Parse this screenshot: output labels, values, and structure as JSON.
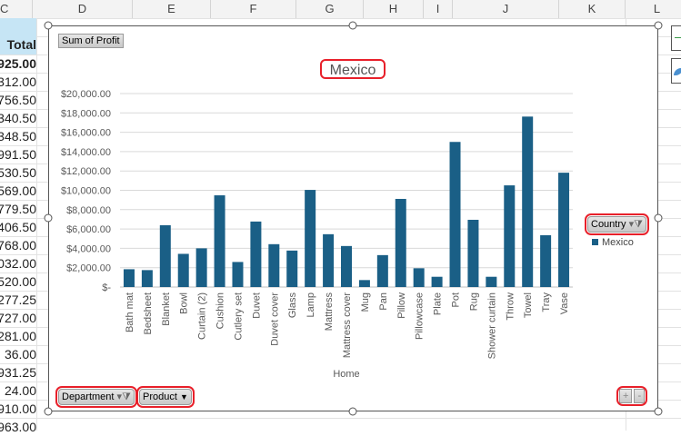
{
  "columns": [
    "C",
    "D",
    "E",
    "F",
    "G",
    "H",
    "I",
    "J",
    "K",
    "L"
  ],
  "left_column": {
    "header": "Total",
    "values": [
      "925.00",
      "312.00",
      "756.50",
      "340.50",
      "348.50",
      "991.50",
      "530.50",
      "569.00",
      "779.50",
      "406.50",
      "768.00",
      "032.00",
      "520.00",
      "277.25",
      "727.00",
      "281.00",
      "36.00",
      "931.25",
      "24.00",
      "910.00",
      "963.00"
    ]
  },
  "chart": {
    "value_field_button": "Sum of Profit",
    "legend_field_button": "Country",
    "axis_field_buttons": [
      "Department",
      "Product"
    ],
    "zoom_buttons": [
      "+",
      "-"
    ],
    "bar_color": "#1a5f86",
    "highlight_color": "#e8202a"
  },
  "chart_data": {
    "type": "bar",
    "title": "Mexico",
    "xlabel": "Home",
    "ylabel": "",
    "ylim": [
      0,
      20000
    ],
    "yticks": [
      "$-",
      "$2,000.00",
      "$4,000.00",
      "$6,000.00",
      "$8,000.00",
      "$10,000.00",
      "$12,000.00",
      "$14,000.00",
      "$16,000.00",
      "$18,000.00",
      "$20,000.00"
    ],
    "grid": true,
    "legend_position": "right",
    "categories": [
      "Bath mat",
      "Bedsheet",
      "Blanket",
      "Bowl",
      "Curtain (2)",
      "Cushion",
      "Cutlery set",
      "Duvet",
      "Duvet cover",
      "Glass",
      "Lamp",
      "Mattress",
      "Mattress cover",
      "Mug",
      "Pan",
      "Pillow",
      "Pillowcase",
      "Plate",
      "Pot",
      "Rug",
      "Shower curtain",
      "Throw",
      "Towel",
      "Tray",
      "Vase"
    ],
    "series": [
      {
        "name": "Mexico",
        "values": [
          1840,
          1750,
          6390,
          3430,
          4000,
          9480,
          2590,
          6770,
          4430,
          3770,
          10040,
          5460,
          4240,
          720,
          3300,
          9110,
          1940,
          1060,
          15000,
          6950,
          1060,
          10510,
          17620,
          5360,
          11820
        ]
      }
    ]
  }
}
